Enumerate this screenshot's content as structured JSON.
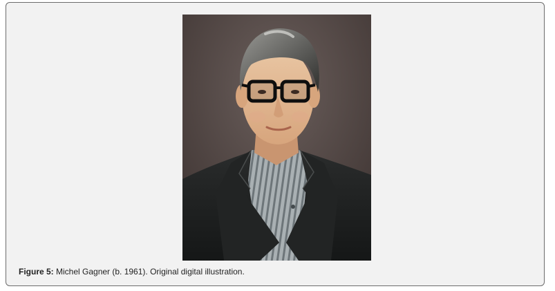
{
  "figure": {
    "label": "Figure 5:",
    "caption": " Michel Gagner (b. 1961). Original digital illustration."
  },
  "colors": {
    "panel_background": "#f2f2f2",
    "panel_border": "#6b6b6b",
    "caption_text": "#222222"
  }
}
